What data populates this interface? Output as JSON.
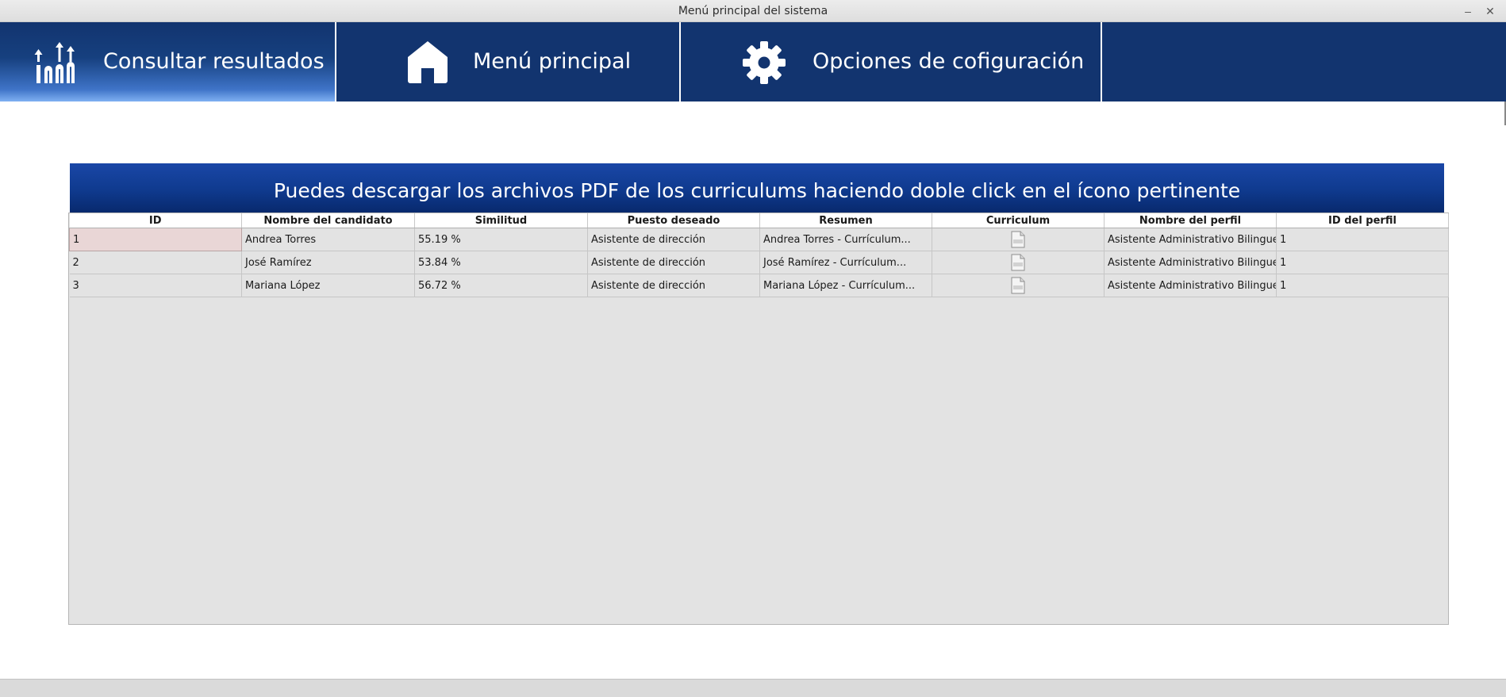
{
  "window": {
    "title": "Menú principal del sistema",
    "minimize_glyph": "–",
    "close_glyph": "✕"
  },
  "nav": {
    "tabs": [
      {
        "label": "Consultar resultados",
        "icon": "ranking-chart-icon",
        "active": true
      },
      {
        "label": "Menú principal",
        "icon": "home-icon",
        "active": false
      },
      {
        "label": "Opciones de cofiguración",
        "icon": "gear-icon",
        "active": false
      }
    ]
  },
  "banner": {
    "text": "Puedes descargar los archivos PDF de los curriculums haciendo doble click en el ícono pertinente"
  },
  "table": {
    "columns": [
      "ID",
      "Nombre del candidato",
      "Similitud",
      "Puesto deseado",
      "Resumen",
      "Curriculum",
      "Nombre del perfil",
      "ID del perfil"
    ],
    "rows": [
      {
        "id": "1",
        "nombre": "Andrea Torres",
        "similitud": "55.19 %",
        "puesto": "Asistente de dirección",
        "resumen": "Andrea Torres - Currículum...",
        "curriculum_icon": "pdf-icon",
        "perfil": "Asistente Administrativo Bilingue",
        "id_perfil": "1"
      },
      {
        "id": "2",
        "nombre": "José Ramírez",
        "similitud": "53.84 %",
        "puesto": "Asistente de dirección",
        "resumen": "José Ramírez - Currículum...",
        "curriculum_icon": "pdf-icon",
        "perfil": "Asistente Administrativo Bilingue",
        "id_perfil": "1"
      },
      {
        "id": "3",
        "nombre": "Mariana López",
        "similitud": "56.72 %",
        "puesto": "Asistente de dirección",
        "resumen": "Mariana López - Currículum...",
        "curriculum_icon": "pdf-icon",
        "perfil": "Asistente Administrativo Bilingue",
        "id_perfil": "1"
      }
    ]
  },
  "colors": {
    "nav_bg": "#12346f",
    "banner_bg": "#0f3a8e",
    "table_bg": "#e3e3e3",
    "selected_cell": "#e9d6d6"
  }
}
